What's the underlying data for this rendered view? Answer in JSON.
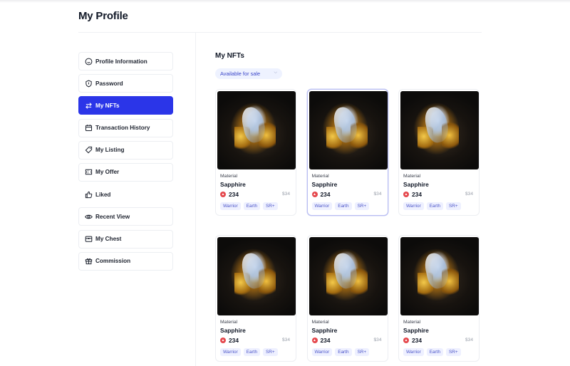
{
  "page": {
    "title": "My Profile"
  },
  "sidebar": {
    "items": [
      {
        "label": "Profile Information",
        "icon": "smile-icon",
        "state": "default"
      },
      {
        "label": "Password",
        "icon": "shield-icon",
        "state": "default"
      },
      {
        "label": "My NFTs",
        "icon": "swap-arrows-icon",
        "state": "active"
      },
      {
        "label": "Transaction History",
        "icon": "calendar-icon",
        "state": "default"
      },
      {
        "label": "My Listing",
        "icon": "tag-icon",
        "state": "default"
      },
      {
        "label": "My Offer",
        "icon": "ticket-icon",
        "state": "default"
      },
      {
        "label": "Liked",
        "icon": "thumbs-up-icon",
        "state": "plain"
      },
      {
        "label": "Recent View",
        "icon": "eye-icon",
        "state": "default"
      },
      {
        "label": "My Chest",
        "icon": "chest-icon",
        "state": "default"
      },
      {
        "label": "Commission",
        "icon": "gift-icon",
        "state": "default"
      }
    ]
  },
  "main": {
    "section_title": "My NFTs",
    "filter": {
      "selected": "Available for sale"
    },
    "cards": [
      {
        "category": "Material",
        "name": "Sapphire",
        "price": "234",
        "usd": "$34",
        "tags": [
          "Warrior",
          "Earth",
          "SR+"
        ],
        "selected": false
      },
      {
        "category": "Material",
        "name": "Sapphire",
        "price": "234",
        "usd": "$34",
        "tags": [
          "Warrior",
          "Earth",
          "SR+"
        ],
        "selected": true
      },
      {
        "category": "Material",
        "name": "Sapphire",
        "price": "234",
        "usd": "$34",
        "tags": [
          "Warrior",
          "Earth",
          "SR+"
        ],
        "selected": false
      },
      {
        "category": "Material",
        "name": "Sapphire",
        "price": "234",
        "usd": "$34",
        "tags": [
          "Warrior",
          "Earth",
          "SR+"
        ],
        "selected": false
      },
      {
        "category": "Material",
        "name": "Sapphire",
        "price": "234",
        "usd": "$34",
        "tags": [
          "Warrior",
          "Earth",
          "SR+"
        ],
        "selected": false
      },
      {
        "category": "Material",
        "name": "Sapphire",
        "price": "234",
        "usd": "$34",
        "tags": [
          "Warrior",
          "Earth",
          "SR+"
        ],
        "selected": false
      }
    ]
  },
  "colors": {
    "accent": "#2b35e8",
    "tag_bg": "#eef0ff",
    "tag_text": "#4b55c8",
    "coin": "#e5484d",
    "filter_bg": "#eef2ff"
  }
}
